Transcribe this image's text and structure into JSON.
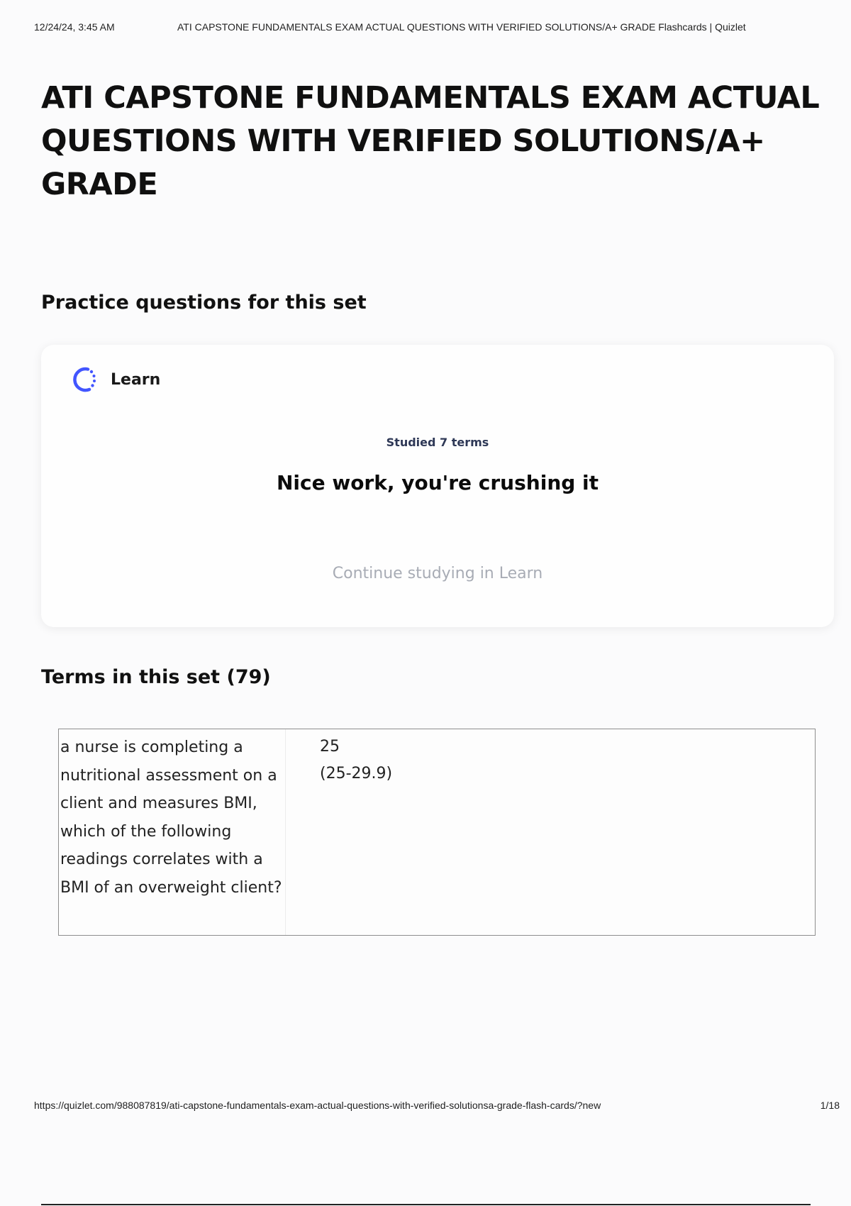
{
  "print_header": {
    "date": "12/24/24, 3:45 AM",
    "doc_title": "ATI CAPSTONE FUNDAMENTALS EXAM ACTUAL QUESTIONS WITH VERIFIED SOLUTIONS/A+ GRADE Flashcards | Quizlet"
  },
  "page": {
    "title": "ATI CAPSTONE FUNDAMENTALS EXAM ACTUAL QUESTIONS WITH VERIFIED SOLUTIONS/A+ GRADE"
  },
  "practice": {
    "heading": "Practice questions for this set",
    "card": {
      "mode_label": "Learn",
      "mode_icon": "learn-progress-icon",
      "studied": "Studied 7 terms",
      "message": "Nice work, you're crushing it",
      "continue_label": "Continue studying in Learn"
    }
  },
  "terms": {
    "heading": "Terms in this set (79)",
    "items": [
      {
        "term": "a nurse is completing a nutritional assessment on a client and measures BMI, which of the following readings correlates with a BMI of an overweight client?",
        "definition": "25\n(25-29.9)"
      }
    ]
  },
  "print_footer": {
    "url": "https://quizlet.com/988087819/ati-capstone-fundamentals-exam-actual-questions-with-verified-solutionsa-grade-flash-cards/?new",
    "page_number": "1/18"
  },
  "colors": {
    "accent": "#4255ff",
    "muted_link": "#a8acb5",
    "studied_text": "#2e3856"
  }
}
